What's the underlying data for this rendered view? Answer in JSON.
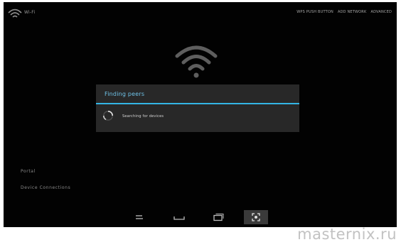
{
  "header": {
    "app_icon": "wifi-icon",
    "app_title": "Wi-Fi",
    "actions": [
      "WPS PUSH BUTTON",
      "ADD NETWORK",
      "ADVANCED"
    ]
  },
  "main": {
    "status_icon": "wifi-signal-icon"
  },
  "dialog": {
    "title": "Finding peers",
    "message": "Searching for devices",
    "accent_color": "#33b5e5"
  },
  "side_list": {
    "items": [
      "Portal",
      "Device Connections"
    ]
  },
  "navbar": {
    "buttons": [
      {
        "icon": "back-icon"
      },
      {
        "icon": "home-icon"
      },
      {
        "icon": "recent-apps-icon"
      },
      {
        "icon": "screenshot-icon",
        "active": true
      }
    ]
  },
  "watermark": "masternix.ru"
}
